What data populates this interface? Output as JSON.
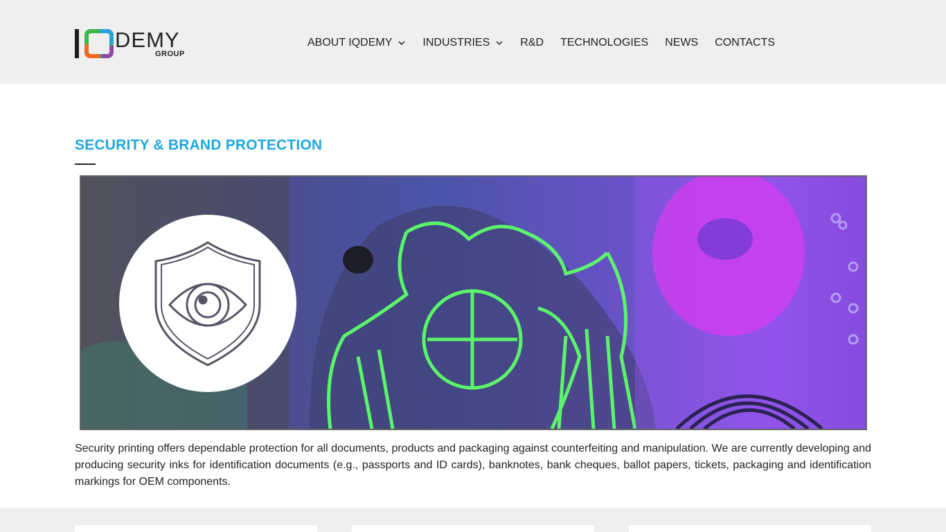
{
  "header": {
    "logo": {
      "wordmark": "DEMY",
      "sub": "GROUP",
      "colors": {
        "orange": "#f26722",
        "green": "#3db54a",
        "blue": "#29a3dd",
        "purple": "#8e4aa8"
      }
    },
    "nav": [
      {
        "label": "ABOUT IQDEMY",
        "has_dropdown": true
      },
      {
        "label": "INDUSTRIES",
        "has_dropdown": true
      },
      {
        "label": "R&D",
        "has_dropdown": false
      },
      {
        "label": "TECHNOLOGIES",
        "has_dropdown": false
      },
      {
        "label": "NEWS",
        "has_dropdown": false
      },
      {
        "label": "CONTACTS",
        "has_dropdown": false
      }
    ]
  },
  "main": {
    "title": "SECURITY & BRAND PROTECTION",
    "title_color": "#1ea7df",
    "banner": {
      "icon": "shield-eye-icon"
    },
    "description": "Security printing offers dependable protection for all documents, products and packaging against counterfeiting and manipulation. We are currently developing and producing security inks for identification documents (e.g., passports and ID cards), banknotes, bank cheques, ballot papers, tickets, packaging and identification markings for OEM components."
  }
}
